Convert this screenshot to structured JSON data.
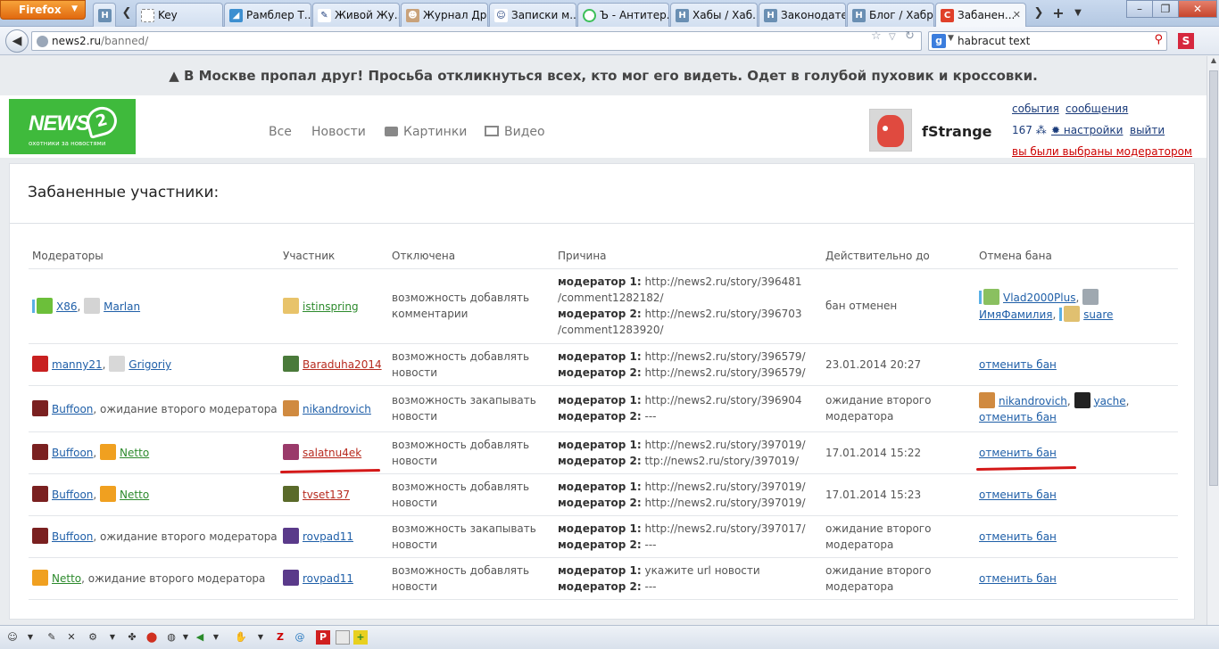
{
  "browser": {
    "firefox_label": "Firefox",
    "tabs": [
      {
        "label": "",
        "icon": "habr-icon"
      },
      {
        "label": "Key",
        "icon": "blank-page-icon"
      },
      {
        "label": "Рамблер Т...",
        "icon": "rambler-icon"
      },
      {
        "label": "Живой Жу...",
        "icon": "livejournal-icon"
      },
      {
        "label": "Журнал Др...",
        "icon": "user-icon"
      },
      {
        "label": "Записки м...",
        "icon": "user-icon"
      },
      {
        "label": "Ъ - Антитер...",
        "icon": "loading-icon"
      },
      {
        "label": "Хабы / Хаб...",
        "icon": "habr-icon"
      },
      {
        "label": "Законодате...",
        "icon": "habr-icon"
      },
      {
        "label": "Блог / Хабр...",
        "icon": "habr-icon"
      },
      {
        "label": "Забанен...",
        "icon": "news2-icon"
      }
    ],
    "url_domain": "news2.ru",
    "url_path": "/banned/",
    "search_text": "habracut text",
    "search_engine_icon": "google-icon"
  },
  "announcement": "В Москве пропал друг! Просьба откликнуться всех, кто мог его видеть. Одет в голубой пуховик и кроссовки.",
  "header": {
    "logo_word": "NEWS",
    "logo_mark": "2",
    "logo_tagline": "охотники за новостями",
    "nav": [
      "Все",
      "Новости",
      "Картинки",
      "Видео"
    ],
    "user_name": "fStrange",
    "links": {
      "events": "события",
      "messages": "сообщения",
      "karma": "167",
      "settings": "настройки",
      "logout": "выйти",
      "moderator_notice": "вы были выбраны модератором"
    }
  },
  "card_title": "Забаненные участники:",
  "table": {
    "columns": [
      "Модераторы",
      "Участник",
      "Отключена",
      "Причина",
      "Действительно до",
      "Отмена бана"
    ],
    "rows": [
      {
        "moderators": [
          {
            "name": "X86",
            "color": "#6cbf3a"
          },
          {
            "name": "Marlan",
            "color": "#d4d4d4"
          }
        ],
        "moderators_suffix": "",
        "user": "istinspring",
        "user_color": "#e8c36a",
        "user_link": "green",
        "disabled": [
          "возможность добавлять",
          "комментарии"
        ],
        "reason": [
          [
            "модератор 1:",
            "http://news2.ru/story/396481"
          ],
          [
            "",
            "/comment1282182/"
          ],
          [
            "модератор 2:",
            "http://news2.ru/story/396703"
          ],
          [
            "",
            "/comment1283920/"
          ]
        ],
        "valid_until": [
          "бан отменен"
        ],
        "unban": [
          [
            "Vlad2000Plus",
            ","
          ],
          [
            "ИмяФамилия",
            ","
          ],
          [
            "suare",
            ""
          ]
        ],
        "unban_link": false
      },
      {
        "moderators": [
          {
            "name": "manny21",
            "color": "#c82020"
          },
          {
            "name": "Grigoriy",
            "color": "#d8d8d8"
          }
        ],
        "moderators_suffix": "",
        "user": "Baraduha2014",
        "user_color": "#4a7a3a",
        "user_link": "red",
        "disabled": [
          "возможность добавлять",
          "новости"
        ],
        "reason": [
          [
            "модератор 1:",
            "http://news2.ru/story/396579/"
          ],
          [
            "модератор 2:",
            "http://news2.ru/story/396579/"
          ]
        ],
        "valid_until": [
          "23.01.2014 20:27"
        ],
        "unban_link": true,
        "unban_label": "отменить бан"
      },
      {
        "moderators": [
          {
            "name": "Buffoon",
            "color": "#7a2020"
          }
        ],
        "moderators_suffix": "ожидание второго модератора",
        "user": "nikandrovich",
        "user_color": "#d08a40",
        "user_link": "blue",
        "disabled": [
          "возможность закапывать",
          "новости"
        ],
        "reason": [
          [
            "модератор 1:",
            "http://news2.ru/story/396904"
          ],
          [
            "модератор 2:",
            "---"
          ]
        ],
        "valid_until": [
          "ожидание второго",
          "модератора"
        ],
        "unban": [
          [
            "nikandrovich",
            ","
          ],
          [
            "yache",
            ","
          ]
        ],
        "unban_link": true,
        "unban_label": "отменить бан"
      },
      {
        "moderators": [
          {
            "name": "Buffoon",
            "color": "#7a2020"
          },
          {
            "name": "Netto",
            "color": "#f0a020"
          }
        ],
        "moderators_suffix": "",
        "user": "salatnu4ek",
        "user_color": "#9a3a6a",
        "user_link": "red",
        "disabled": [
          "возможность добавлять",
          "новости"
        ],
        "reason": [
          [
            "модератор 1:",
            "http://news2.ru/story/397019/"
          ],
          [
            "модератор 2:",
            "ttp://news2.ru/story/397019/"
          ]
        ],
        "valid_until": [
          "17.01.2014 15:22"
        ],
        "unban_link": true,
        "unban_label": "отменить бан"
      },
      {
        "moderators": [
          {
            "name": "Buffoon",
            "color": "#7a2020"
          },
          {
            "name": "Netto",
            "color": "#f0a020"
          }
        ],
        "moderators_suffix": "",
        "user": "tvset137",
        "user_color": "#5a6a2a",
        "user_link": "red",
        "disabled": [
          "возможность добавлять",
          "новости"
        ],
        "reason": [
          [
            "модератор 1:",
            "http://news2.ru/story/397019/"
          ],
          [
            "модератор 2:",
            "http://news2.ru/story/397019/"
          ]
        ],
        "valid_until": [
          "17.01.2014 15:23"
        ],
        "unban_link": true,
        "unban_label": "отменить бан"
      },
      {
        "moderators": [
          {
            "name": "Buffoon",
            "color": "#7a2020"
          }
        ],
        "moderators_suffix": "ожидание второго модератора",
        "user": "rovpad11",
        "user_color": "#5a3a8a",
        "user_link": "blue",
        "disabled": [
          "возможность закапывать",
          "новости"
        ],
        "reason": [
          [
            "модератор 1:",
            "http://news2.ru/story/397017/"
          ],
          [
            "модератор 2:",
            "---"
          ]
        ],
        "valid_until": [
          "ожидание второго",
          "модератора"
        ],
        "unban_link": true,
        "unban_label": "отменить бан"
      },
      {
        "moderators": [
          {
            "name": "Netto",
            "color": "#f0a020"
          }
        ],
        "moderators_suffix": "ожидание второго модератора",
        "user": "rovpad11",
        "user_color": "#5a3a8a",
        "user_link": "blue",
        "disabled": [
          "возможность добавлять",
          "новости"
        ],
        "reason": [
          [
            "модератор 1:",
            "укажите url новости"
          ],
          [
            "модератор 2:",
            "---"
          ]
        ],
        "valid_until": [
          "ожидание второго",
          "модератора"
        ],
        "unban_link": true,
        "unban_label": "отменить бан"
      }
    ]
  },
  "addon_icons": [
    "smiley-icon",
    "pencil-icon",
    "close-icon",
    "gear-icon",
    "puzzle-icon",
    "stop-icon",
    "globe-icon",
    "volume-icon",
    "hand-icon",
    "zotero-icon",
    "at-icon",
    "pdf-icon",
    "notes-icon",
    "plus-icon"
  ]
}
